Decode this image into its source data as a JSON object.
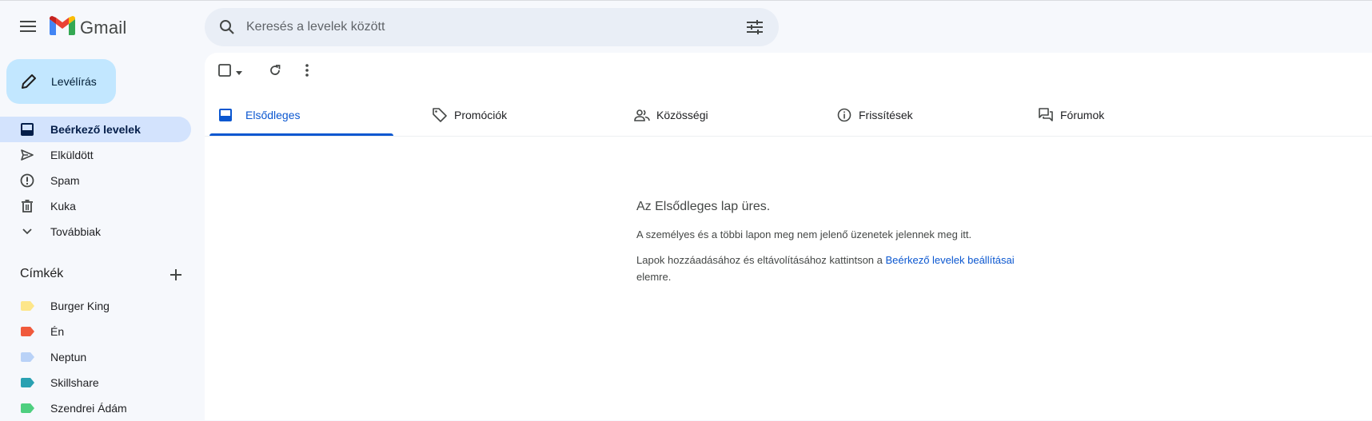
{
  "header": {
    "app_name": "Gmail",
    "search_placeholder": "Keresés a levelek között"
  },
  "sidebar": {
    "compose_label": "Levélírás",
    "items": [
      {
        "label": "Beérkező levelek",
        "icon": "inbox-icon",
        "active": true
      },
      {
        "label": "Elküldött",
        "icon": "send-icon"
      },
      {
        "label": "Spam",
        "icon": "spam-icon"
      },
      {
        "label": "Kuka",
        "icon": "trash-icon"
      },
      {
        "label": "Továbbiak",
        "icon": "chevron-down-icon"
      }
    ],
    "labels_title": "Címkék",
    "labels": [
      {
        "label": "Burger King",
        "color": "#fde68a"
      },
      {
        "label": "Én",
        "color": "#f05a3c"
      },
      {
        "label": "Neptun",
        "color": "#b9d2f7"
      },
      {
        "label": "Skillshare",
        "color": "#2aa1b2"
      },
      {
        "label": "Szendrei Ádám",
        "color": "#4ecf7f"
      }
    ]
  },
  "tabs": [
    {
      "label": "Elsődleges",
      "icon": "inbox-icon",
      "active": true
    },
    {
      "label": "Promóciók",
      "icon": "tag-icon"
    },
    {
      "label": "Közösségi",
      "icon": "people-icon"
    },
    {
      "label": "Frissítések",
      "icon": "info-icon"
    },
    {
      "label": "Fórumok",
      "icon": "forum-icon"
    }
  ],
  "empty_state": {
    "title": "Az Elsődleges lap üres.",
    "line1": "A személyes és a többi lapon meg nem jelenő üzenetek jelennek meg itt.",
    "line2_prefix": "Lapok hozzáadásához és eltávolításához kattintson a ",
    "line2_link": "Beérkező levelek beállításai",
    "line2_suffix": "elemre."
  },
  "colors": {
    "accent": "#0b57d0",
    "compose_bg": "#c2e7ff",
    "active_nav_bg": "#d3e3fd",
    "search_bg": "#e9eef6"
  }
}
